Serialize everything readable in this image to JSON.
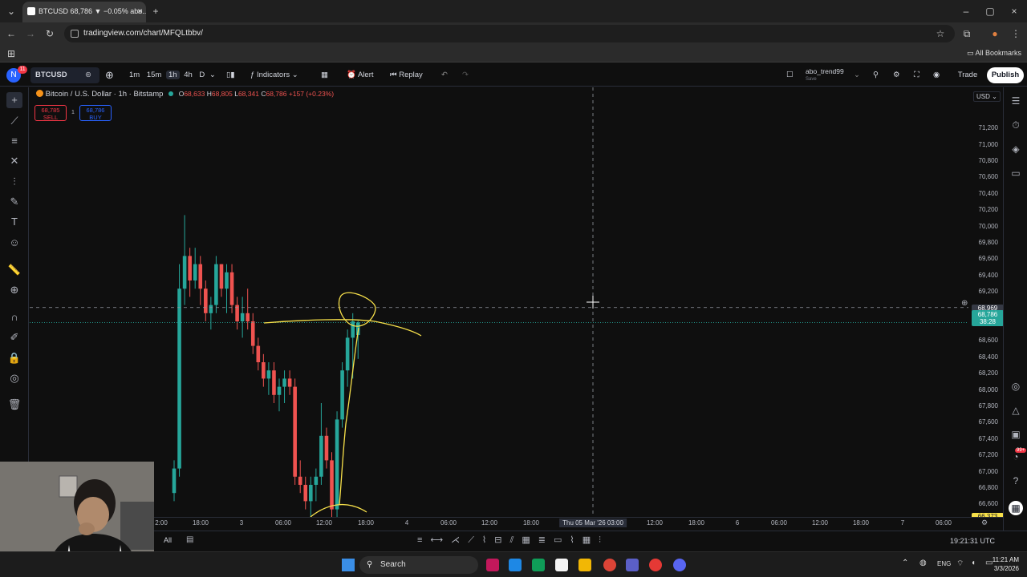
{
  "browser": {
    "tab_title": "BTCUSD 68,786 ▼ −0.05% abo...",
    "url": "tradingview.com/chart/MFQLtbbv/",
    "bookmarks_label": "All Bookmarks"
  },
  "toolbar": {
    "symbol": "BTCUSD",
    "intervals": [
      "1m",
      "15m",
      "1h",
      "4h",
      "D"
    ],
    "active_interval": "1h",
    "indicators_label": "Indicators",
    "alert_label": "Alert",
    "replay_label": "Replay",
    "layout_name": "abo_trend99",
    "layout_sub": "Save",
    "trade_label": "Trade",
    "publish_label": "Publish",
    "avatar_letter": "N",
    "notif_count": "11"
  },
  "legend": {
    "title": "Bitcoin / U.S. Dollar · 1h · Bitstamp",
    "o": "68,633",
    "h": "68,805",
    "l": "68,341",
    "c": "68,786",
    "change": "+157 (+0.23%)",
    "sell_price": "68,785",
    "sell_label": "SELL",
    "spread": "1",
    "buy_price": "68,786",
    "buy_label": "BUY"
  },
  "price_axis": {
    "currency": "USD",
    "ticks": [
      "71,200",
      "71,000",
      "70,800",
      "70,600",
      "70,400",
      "70,200",
      "70,000",
      "69,800",
      "69,600",
      "69,400",
      "69,200",
      "68,600",
      "68,400",
      "68,200",
      "68,000",
      "67,800",
      "67,600",
      "67,400",
      "67,200",
      "67,000",
      "66,800",
      "66,600"
    ],
    "crosshair_price": "68,969",
    "last_price": "68,786",
    "countdown": "38:28",
    "low_label": "66,373"
  },
  "time_axis": {
    "ticks": [
      "2:00",
      "18:00",
      "3",
      "06:00",
      "12:00",
      "18:00",
      "4",
      "06:00",
      "12:00",
      "18:00",
      "12:00",
      "18:00",
      "6",
      "06:00",
      "12:00",
      "18:00",
      "7",
      "06:00"
    ],
    "crosshair_time": "Thu 05 Mar '26  03:00"
  },
  "bottom": {
    "all_label": "All",
    "clock": "19:21:31 UTC"
  },
  "taskbar": {
    "search_placeholder": "Search",
    "lang": "ENG",
    "time": "11:21 AM",
    "date": "3/3/2026",
    "badge": "99+"
  },
  "chart_data": {
    "type": "candlestick",
    "candles": [
      {
        "o": 66700,
        "h": 67100,
        "l": 66600,
        "c": 67000
      },
      {
        "o": 67000,
        "h": 69500,
        "l": 66900,
        "c": 69200
      },
      {
        "o": 69200,
        "h": 70100,
        "l": 69000,
        "c": 69600
      },
      {
        "o": 69600,
        "h": 69700,
        "l": 69100,
        "c": 69300
      },
      {
        "o": 69300,
        "h": 69700,
        "l": 69200,
        "c": 69500
      },
      {
        "o": 69500,
        "h": 69600,
        "l": 69000,
        "c": 69200
      },
      {
        "o": 69200,
        "h": 69300,
        "l": 68800,
        "c": 68900
      },
      {
        "o": 68900,
        "h": 69100,
        "l": 68700,
        "c": 69000
      },
      {
        "o": 69000,
        "h": 69600,
        "l": 68900,
        "c": 69500
      },
      {
        "o": 69500,
        "h": 69500,
        "l": 69100,
        "c": 69200
      },
      {
        "o": 69200,
        "h": 69500,
        "l": 68900,
        "c": 69400
      },
      {
        "o": 69400,
        "h": 69500,
        "l": 68900,
        "c": 69000
      },
      {
        "o": 69000,
        "h": 69100,
        "l": 68700,
        "c": 68800
      },
      {
        "o": 68800,
        "h": 69100,
        "l": 68600,
        "c": 68900
      },
      {
        "o": 68900,
        "h": 69200,
        "l": 68700,
        "c": 68800
      },
      {
        "o": 68800,
        "h": 68900,
        "l": 68400,
        "c": 68500
      },
      {
        "o": 68500,
        "h": 68600,
        "l": 68200,
        "c": 68300
      },
      {
        "o": 68300,
        "h": 68400,
        "l": 68000,
        "c": 68100
      },
      {
        "o": 68100,
        "h": 68300,
        "l": 67900,
        "c": 68200
      },
      {
        "o": 68200,
        "h": 68300,
        "l": 67800,
        "c": 67900
      },
      {
        "o": 67900,
        "h": 68100,
        "l": 67700,
        "c": 68000
      },
      {
        "o": 68000,
        "h": 68200,
        "l": 67800,
        "c": 68100
      },
      {
        "o": 68100,
        "h": 68200,
        "l": 67900,
        "c": 68000
      },
      {
        "o": 68000,
        "h": 68100,
        "l": 66800,
        "c": 66900
      },
      {
        "o": 66900,
        "h": 67100,
        "l": 66700,
        "c": 66800
      },
      {
        "o": 66800,
        "h": 66900,
        "l": 66500,
        "c": 66600
      },
      {
        "o": 66600,
        "h": 66900,
        "l": 66400,
        "c": 66800
      },
      {
        "o": 66800,
        "h": 67000,
        "l": 66600,
        "c": 66900
      },
      {
        "o": 66900,
        "h": 67800,
        "l": 66800,
        "c": 67400
      },
      {
        "o": 67400,
        "h": 67500,
        "l": 67000,
        "c": 67100
      },
      {
        "o": 67100,
        "h": 67200,
        "l": 66400,
        "c": 66500
      },
      {
        "o": 66500,
        "h": 67700,
        "l": 66400,
        "c": 67600
      },
      {
        "o": 67600,
        "h": 68300,
        "l": 67500,
        "c": 68200
      },
      {
        "o": 68200,
        "h": 68700,
        "l": 68000,
        "c": 68600
      },
      {
        "o": 68600,
        "h": 68900,
        "l": 68100,
        "c": 68800
      },
      {
        "o": 68633,
        "h": 68805,
        "l": 68341,
        "c": 68786
      }
    ],
    "ylim": [
      66373,
      71300
    ]
  }
}
